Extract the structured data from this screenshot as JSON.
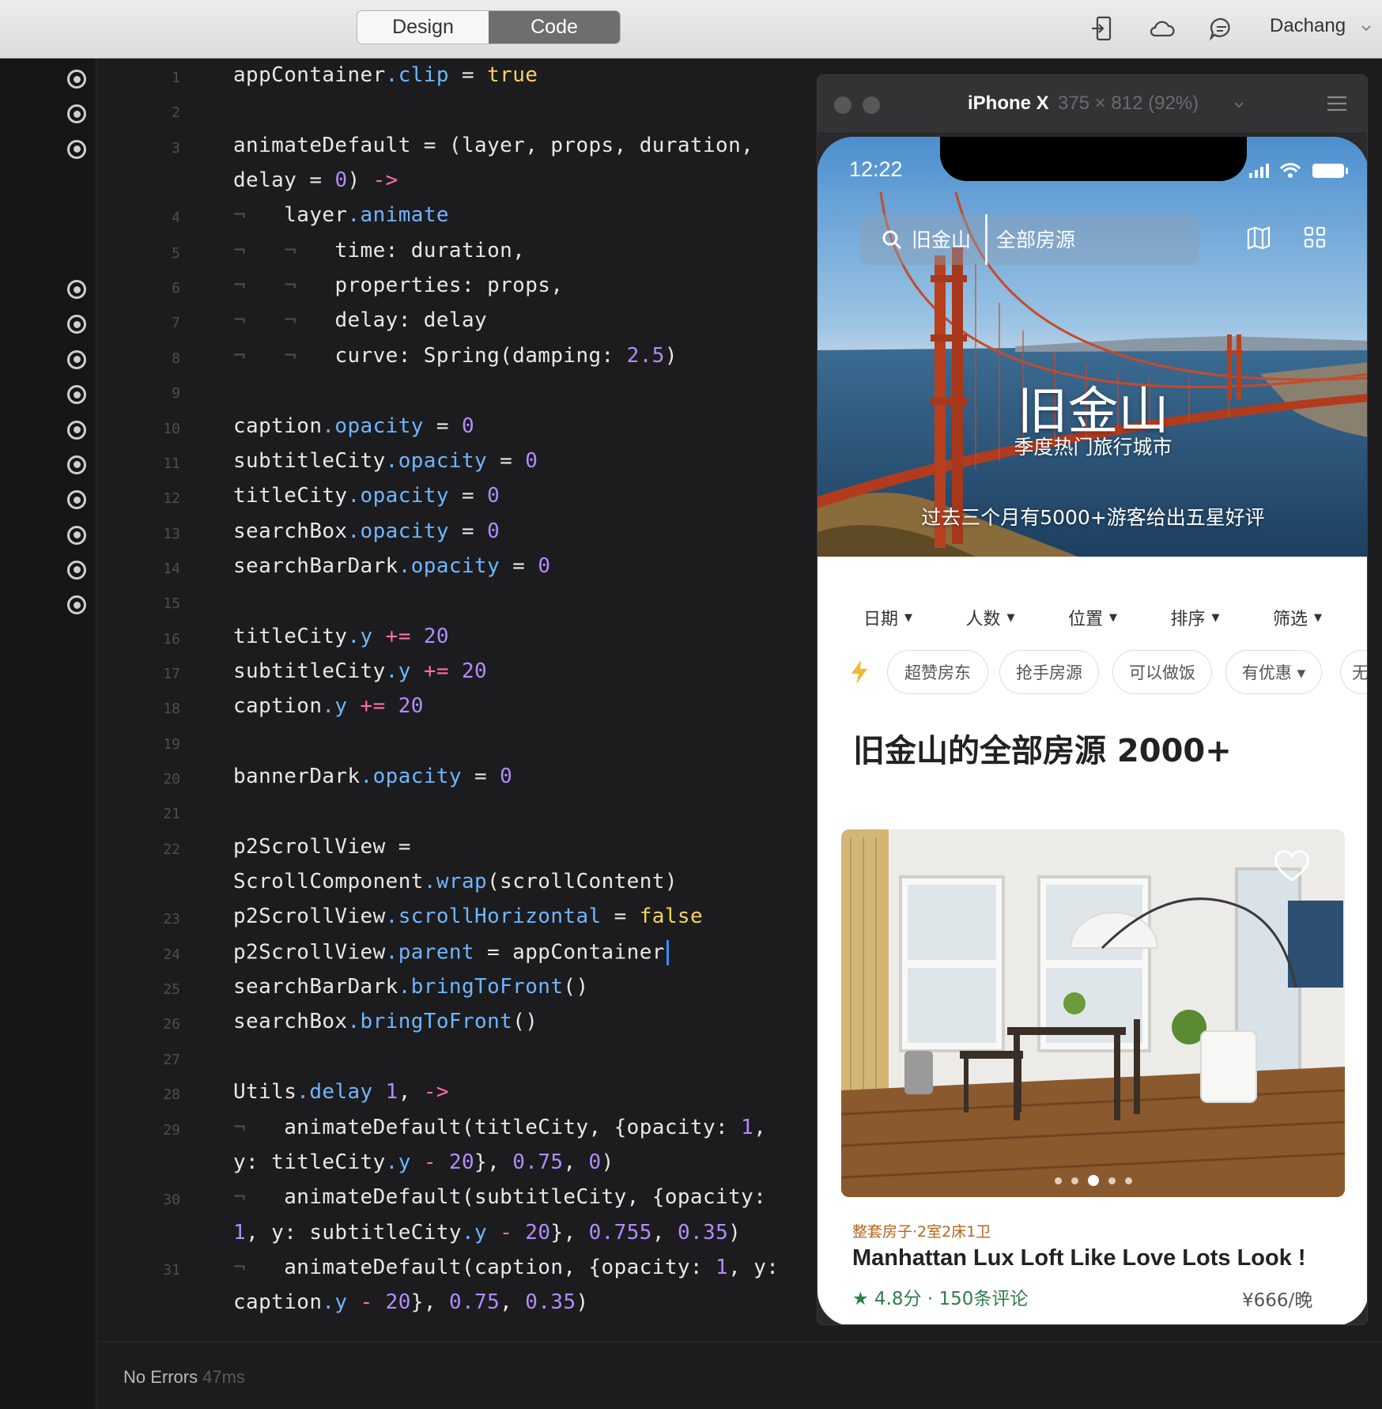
{
  "toolbar": {
    "tabs": [
      {
        "label": "Design",
        "active": false
      },
      {
        "label": "Code",
        "active": true
      }
    ],
    "icons": [
      "device-preview-icon",
      "cloud-icon",
      "comment-icon"
    ],
    "user": "Dachang"
  },
  "editor": {
    "lines": [
      {
        "n": "1",
        "segs": [
          [
            "appContainer",
            ""
          ],
          [
            ".clip",
            "blue"
          ],
          [
            " = ",
            ""
          ],
          [
            "true",
            "yellow"
          ]
        ]
      },
      {
        "n": "2",
        "segs": []
      },
      {
        "n": "3",
        "segs": [
          [
            "animateDefault = (layer, props, duration,",
            ""
          ]
        ]
      },
      {
        "n": "",
        "segs": [
          [
            "delay = ",
            ""
          ],
          [
            "0",
            "purple"
          ],
          [
            ") ",
            ""
          ],
          [
            "->",
            "pink"
          ]
        ]
      },
      {
        "n": "4",
        "segs": [
          [
            "¬   ",
            "gray"
          ],
          [
            "layer",
            ""
          ],
          [
            ".animate",
            "blue"
          ]
        ]
      },
      {
        "n": "5",
        "segs": [
          [
            "¬   ¬   ",
            "gray"
          ],
          [
            "time: duration,",
            ""
          ]
        ]
      },
      {
        "n": "6",
        "segs": [
          [
            "¬   ¬   ",
            "gray"
          ],
          [
            "properties: props,",
            ""
          ]
        ]
      },
      {
        "n": "7",
        "segs": [
          [
            "¬   ¬   ",
            "gray"
          ],
          [
            "delay: delay",
            ""
          ]
        ]
      },
      {
        "n": "8",
        "segs": [
          [
            "¬   ¬   ",
            "gray"
          ],
          [
            "curve: Spring(damping: ",
            ""
          ],
          [
            "2.5",
            "purple"
          ],
          [
            ")",
            ""
          ]
        ]
      },
      {
        "n": "9",
        "segs": []
      },
      {
        "n": "10",
        "segs": [
          [
            "caption",
            ""
          ],
          [
            ".opacity",
            "blue"
          ],
          [
            " = ",
            ""
          ],
          [
            "0",
            "purple"
          ]
        ]
      },
      {
        "n": "11",
        "segs": [
          [
            "subtitleCity",
            ""
          ],
          [
            ".opacity",
            "blue"
          ],
          [
            " = ",
            ""
          ],
          [
            "0",
            "purple"
          ]
        ]
      },
      {
        "n": "12",
        "segs": [
          [
            "titleCity",
            ""
          ],
          [
            ".opacity",
            "blue"
          ],
          [
            " = ",
            ""
          ],
          [
            "0",
            "purple"
          ]
        ]
      },
      {
        "n": "13",
        "segs": [
          [
            "searchBox",
            ""
          ],
          [
            ".opacity",
            "blue"
          ],
          [
            " = ",
            ""
          ],
          [
            "0",
            "purple"
          ]
        ]
      },
      {
        "n": "14",
        "segs": [
          [
            "searchBarDark",
            ""
          ],
          [
            ".opacity",
            "blue"
          ],
          [
            " = ",
            ""
          ],
          [
            "0",
            "purple"
          ]
        ]
      },
      {
        "n": "15",
        "segs": []
      },
      {
        "n": "16",
        "segs": [
          [
            "titleCity",
            ""
          ],
          [
            ".y",
            "blue"
          ],
          [
            " ",
            ""
          ],
          [
            "+=",
            "pink"
          ],
          [
            " ",
            ""
          ],
          [
            "20",
            "purple"
          ]
        ]
      },
      {
        "n": "17",
        "segs": [
          [
            "subtitleCity",
            ""
          ],
          [
            ".y",
            "blue"
          ],
          [
            " ",
            ""
          ],
          [
            "+=",
            "pink"
          ],
          [
            " ",
            ""
          ],
          [
            "20",
            "purple"
          ]
        ]
      },
      {
        "n": "18",
        "segs": [
          [
            "caption",
            ""
          ],
          [
            ".y",
            "blue"
          ],
          [
            " ",
            ""
          ],
          [
            "+=",
            "pink"
          ],
          [
            " ",
            ""
          ],
          [
            "20",
            "purple"
          ]
        ]
      },
      {
        "n": "19",
        "segs": []
      },
      {
        "n": "20",
        "segs": [
          [
            "bannerDark",
            ""
          ],
          [
            ".opacity",
            "blue"
          ],
          [
            " = ",
            ""
          ],
          [
            "0",
            "purple"
          ]
        ]
      },
      {
        "n": "21",
        "segs": []
      },
      {
        "n": "22",
        "segs": [
          [
            "p2ScrollView =",
            ""
          ]
        ]
      },
      {
        "n": "",
        "segs": [
          [
            "ScrollComponent",
            ""
          ],
          [
            ".wrap",
            "blue"
          ],
          [
            "(scrollContent)",
            ""
          ]
        ]
      },
      {
        "n": "23",
        "segs": [
          [
            "p2ScrollView",
            ""
          ],
          [
            ".scrollHorizontal",
            "blue"
          ],
          [
            " = ",
            ""
          ],
          [
            "false",
            "yellow"
          ]
        ]
      },
      {
        "n": "24",
        "segs": [
          [
            "p2ScrollView",
            ""
          ],
          [
            ".parent",
            "blue"
          ],
          [
            " = appContainer",
            ""
          ]
        ],
        "caret": true
      },
      {
        "n": "25",
        "segs": [
          [
            "searchBarDark",
            ""
          ],
          [
            ".bringToFront",
            "blue"
          ],
          [
            "()",
            ""
          ]
        ]
      },
      {
        "n": "26",
        "segs": [
          [
            "searchBox",
            ""
          ],
          [
            ".bringToFront",
            "blue"
          ],
          [
            "()",
            ""
          ]
        ]
      },
      {
        "n": "27",
        "segs": []
      },
      {
        "n": "28",
        "segs": [
          [
            "Utils",
            ""
          ],
          [
            ".delay",
            "blue"
          ],
          [
            " ",
            ""
          ],
          [
            "1",
            "purple"
          ],
          [
            ", ",
            ""
          ],
          [
            "->",
            "pink"
          ]
        ]
      },
      {
        "n": "29",
        "segs": [
          [
            "¬   ",
            "gray"
          ],
          [
            "animateDefault(titleCity, {opacity: ",
            ""
          ],
          [
            "1",
            "purple"
          ],
          [
            ",",
            ""
          ]
        ]
      },
      {
        "n": "",
        "segs": [
          [
            "y: titleCity",
            ""
          ],
          [
            ".y",
            "blue"
          ],
          [
            " ",
            ""
          ],
          [
            "-",
            "pink"
          ],
          [
            " ",
            ""
          ],
          [
            "20",
            "purple"
          ],
          [
            "}, ",
            ""
          ],
          [
            "0.75",
            "purple"
          ],
          [
            ", ",
            ""
          ],
          [
            "0",
            "purple"
          ],
          [
            ")",
            ""
          ]
        ]
      },
      {
        "n": "30",
        "segs": [
          [
            "¬   ",
            "gray"
          ],
          [
            "animateDefault(subtitleCity, {opacity:",
            ""
          ]
        ]
      },
      {
        "n": "",
        "segs": [
          [
            "1",
            "purple"
          ],
          [
            ", y: subtitleCity",
            ""
          ],
          [
            ".y",
            "blue"
          ],
          [
            " ",
            ""
          ],
          [
            "-",
            "pink"
          ],
          [
            " ",
            ""
          ],
          [
            "20",
            "purple"
          ],
          [
            "}, ",
            ""
          ],
          [
            "0.755",
            "purple"
          ],
          [
            ", ",
            ""
          ],
          [
            "0.35",
            "purple"
          ],
          [
            ")",
            ""
          ]
        ]
      },
      {
        "n": "31",
        "segs": [
          [
            "¬   ",
            "gray"
          ],
          [
            "animateDefault(caption, {opacity: ",
            ""
          ],
          [
            "1",
            "purple"
          ],
          [
            ", y:",
            ""
          ]
        ]
      },
      {
        "n": "",
        "segs": [
          [
            "caption",
            ""
          ],
          [
            ".y",
            "blue"
          ],
          [
            " ",
            ""
          ],
          [
            "-",
            "pink"
          ],
          [
            " ",
            ""
          ],
          [
            "20",
            "purple"
          ],
          [
            "}, ",
            ""
          ],
          [
            "0.75",
            "purple"
          ],
          [
            ", ",
            ""
          ],
          [
            "0.35",
            "purple"
          ],
          [
            ")",
            ""
          ]
        ]
      }
    ]
  },
  "gutter": {
    "breakpoint_rows": [
      0,
      1,
      2,
      6,
      7,
      8,
      9,
      10,
      11,
      12,
      13,
      14,
      15
    ]
  },
  "status": {
    "message": "No Errors",
    "timing": "47ms"
  },
  "preview": {
    "device": "iPhone X",
    "size": "375 × 812 (92%)",
    "phone": {
      "time": "12:22",
      "search_city": "旧金山",
      "search_all": "全部房源",
      "hero_title": "旧金山",
      "hero_subtitle": "季度热门旅行城市",
      "hero_caption": "过去三个月有5000+游客给出五星好评",
      "filters": [
        "日期",
        "人数",
        "位置",
        "排序",
        "筛选"
      ],
      "chips": [
        {
          "label": "超赞房东"
        },
        {
          "label": "抢手房源"
        },
        {
          "label": "可以做饭"
        },
        {
          "label": "有优惠 ▾"
        },
        {
          "label": "无"
        }
      ],
      "list_title": "旧金山的全部房源 2000+",
      "listing": {
        "type": "整套房子·2室2床1卫",
        "name": "Manhattan Lux Loft Like Love Lots Look !",
        "rating": "★ 4.8分 · 150条评论",
        "price": "¥666/晚",
        "photo_count": 5,
        "active_photo": 2
      }
    }
  },
  "colors": {
    "code_blue": "#6fb6ff",
    "code_purple": "#b38cff",
    "code_pink": "#ff6fa8",
    "code_yellow": "#f7d35c",
    "rating_green": "#2e7d4f",
    "listing_type": "#b5651d"
  }
}
